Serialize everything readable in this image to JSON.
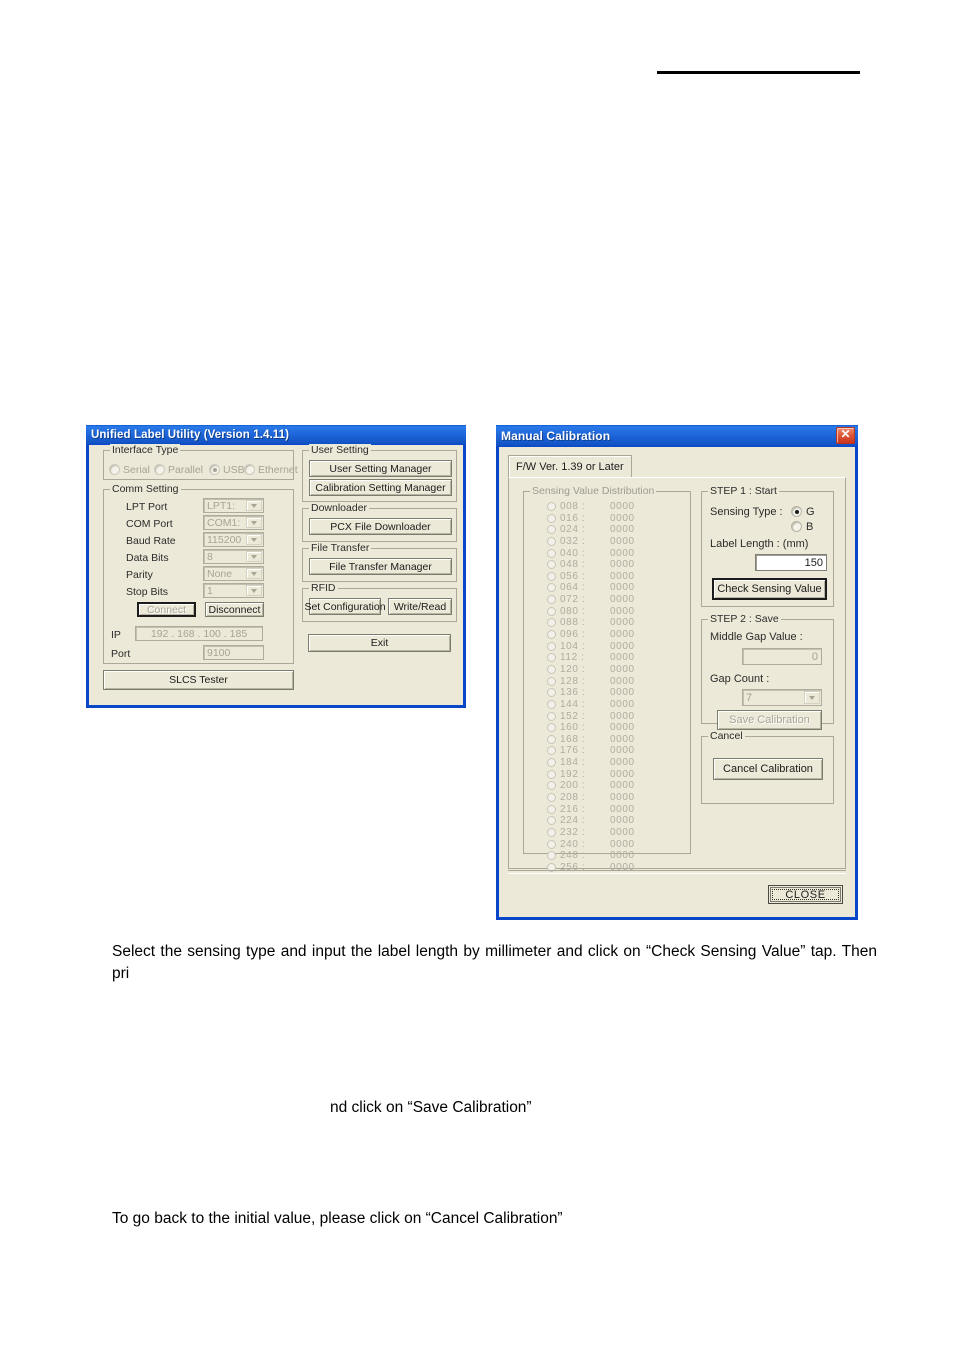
{
  "page": {
    "background": "#ffffff",
    "header_rule": true
  },
  "paragraphs": {
    "p1": "Select the sensing type and input the label length by millimeter and click on “Check Sensing Value” tap. Then pri",
    "p2": "nd click on “Save Calibration”",
    "p3": "To go back to the initial value, please click on “Cancel Calibration”"
  },
  "colors": {
    "titlebar_blue": "#1f68dd",
    "window_face": "#ece9d8",
    "close_red": "#c8341c",
    "groupbox_border": "#aca899",
    "disabled_text": "#a7a396"
  },
  "utility_window": {
    "title": "Unified Label Utility  (Version 1.4.11)",
    "interface_type": {
      "legend": "Interface Type",
      "options": [
        {
          "label": "Serial",
          "selected": false
        },
        {
          "label": "Parallel",
          "selected": false
        },
        {
          "label": "USB",
          "selected": true
        },
        {
          "label": "Ethernet",
          "selected": false
        }
      ]
    },
    "comm_setting": {
      "legend": "Comm Setting",
      "rows": [
        {
          "label": "LPT Port",
          "value": "LPT1:",
          "type": "combo"
        },
        {
          "label": "COM Port",
          "value": "COM1:",
          "type": "combo"
        },
        {
          "label": "Baud Rate",
          "value": "115200",
          "type": "combo"
        },
        {
          "label": "Data Bits",
          "value": "8",
          "type": "combo"
        },
        {
          "label": "Parity",
          "value": "None",
          "type": "combo"
        },
        {
          "label": "Stop Bits",
          "value": "1",
          "type": "combo"
        }
      ],
      "connect_label": "Connect",
      "disconnect_label": "Disconnect",
      "ip_label": "IP",
      "ip_value": "192  .  168  .  100  .  185",
      "port_label": "Port",
      "port_value": "9100"
    },
    "slcs_tester_label": "SLCS Tester",
    "user_setting": {
      "legend": "User Setting",
      "buttons": [
        "User Setting Manager",
        "Calibration Setting Manager"
      ]
    },
    "downloader": {
      "legend": "Downloader",
      "buttons": [
        "PCX File Downloader"
      ]
    },
    "file_transfer": {
      "legend": "File Transfer",
      "buttons": [
        "File Transfer Manager"
      ]
    },
    "rfid": {
      "legend": "RFID",
      "buttons": [
        "Set Configuration",
        "Write/Read"
      ]
    },
    "exit_label": "Exit"
  },
  "calibration_window": {
    "title": "Manual Calibration",
    "close_icon": "close-icon",
    "tab_label": "F/W Ver. 1.39 or Later",
    "sensing_distribution": {
      "legend": "Sensing Value Distribution",
      "rows": [
        {
          "index": "008 :",
          "value": "0000"
        },
        {
          "index": "016 :",
          "value": "0000"
        },
        {
          "index": "024 :",
          "value": "0000"
        },
        {
          "index": "032 :",
          "value": "0000"
        },
        {
          "index": "040 :",
          "value": "0000"
        },
        {
          "index": "048 :",
          "value": "0000"
        },
        {
          "index": "056 :",
          "value": "0000"
        },
        {
          "index": "064 :",
          "value": "0000"
        },
        {
          "index": "072 :",
          "value": "0000"
        },
        {
          "index": "080 :",
          "value": "0000"
        },
        {
          "index": "088 :",
          "value": "0000"
        },
        {
          "index": "096 :",
          "value": "0000"
        },
        {
          "index": "104 :",
          "value": "0000"
        },
        {
          "index": "112 :",
          "value": "0000"
        },
        {
          "index": "120 :",
          "value": "0000"
        },
        {
          "index": "128 :",
          "value": "0000"
        },
        {
          "index": "136 :",
          "value": "0000"
        },
        {
          "index": "144 :",
          "value": "0000"
        },
        {
          "index": "152 :",
          "value": "0000"
        },
        {
          "index": "160 :",
          "value": "0000"
        },
        {
          "index": "168 :",
          "value": "0000"
        },
        {
          "index": "176 :",
          "value": "0000"
        },
        {
          "index": "184 :",
          "value": "0000"
        },
        {
          "index": "192 :",
          "value": "0000"
        },
        {
          "index": "200 :",
          "value": "0000"
        },
        {
          "index": "208 :",
          "value": "0000"
        },
        {
          "index": "216 :",
          "value": "0000"
        },
        {
          "index": "224 :",
          "value": "0000"
        },
        {
          "index": "232 :",
          "value": "0000"
        },
        {
          "index": "240 :",
          "value": "0000"
        },
        {
          "index": "248 :",
          "value": "0000"
        },
        {
          "index": "256 :",
          "value": "0000"
        }
      ]
    },
    "step1": {
      "legend": "STEP 1 : Start",
      "sensing_type_label": "Sensing Type :",
      "sensing_options": [
        {
          "label": "G",
          "selected": true
        },
        {
          "label": "B",
          "selected": false
        }
      ],
      "label_length_label": "Label Length : (mm)",
      "label_length_value": "150",
      "check_button": "Check Sensing Value"
    },
    "step2": {
      "legend": "STEP 2 : Save",
      "middle_gap_label": "Middle Gap Value :",
      "middle_gap_value": "0",
      "gap_count_label": "Gap Count :",
      "gap_count_value": "7",
      "save_button": "Save Calibration"
    },
    "cancel": {
      "legend": "Cancel",
      "cancel_button": "Cancel Calibration"
    },
    "close_button": "CLOSE"
  }
}
